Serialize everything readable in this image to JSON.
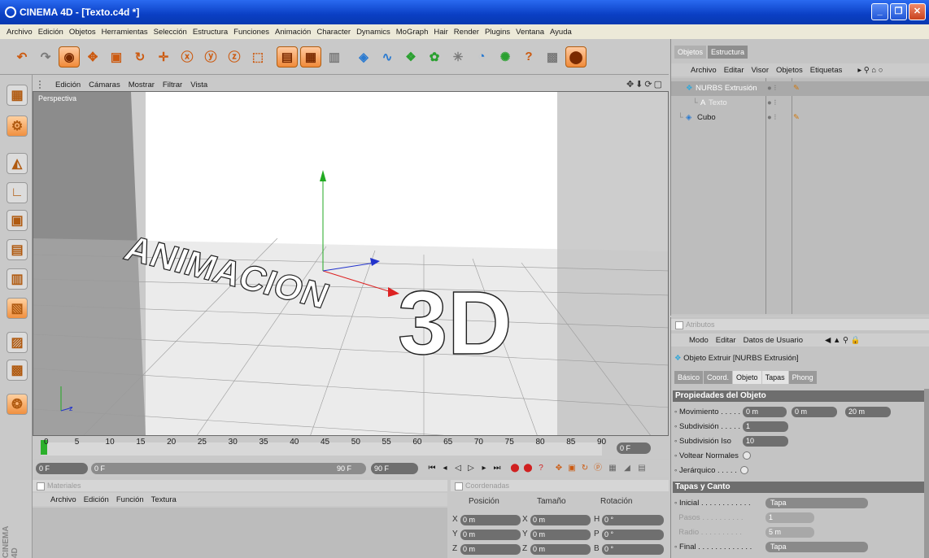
{
  "window": {
    "title": "CINEMA 4D - [Texto.c4d *]"
  },
  "menu": [
    "Archivo",
    "Edición",
    "Objetos",
    "Herramientas",
    "Selección",
    "Estructura",
    "Funciones",
    "Animación",
    "Character",
    "Dynamics",
    "MoGraph",
    "Hair",
    "Render",
    "Plugins",
    "Ventana",
    "Ayuda"
  ],
  "viewport": {
    "menu": [
      "Edición",
      "Cámaras",
      "Mostrar",
      "Filtrar",
      "Vista"
    ],
    "label": "Perspectiva",
    "text_left": "ANIMACION",
    "text_right": "3D"
  },
  "timeline": {
    "ticks": [
      "0",
      "5",
      "10",
      "15",
      "20",
      "25",
      "30",
      "35",
      "40",
      "45",
      "50",
      "55",
      "60",
      "65",
      "70",
      "75",
      "80",
      "85",
      "90"
    ],
    "current_frame": "0 F",
    "start": "0 F",
    "range_left": "0 F",
    "range_right": "90 F",
    "end": "90 F"
  },
  "materials": {
    "title": "Materiales",
    "menu": [
      "Archivo",
      "Edición",
      "Función",
      "Textura"
    ]
  },
  "coords": {
    "title": "Coordenadas",
    "headers": [
      "Posición",
      "Tamaño",
      "Rotación"
    ],
    "rows": [
      {
        "a": "X",
        "av": "0 m",
        "b": "X",
        "bv": "0 m",
        "c": "H",
        "cv": "0 °"
      },
      {
        "a": "Y",
        "av": "0 m",
        "b": "Y",
        "bv": "0 m",
        "c": "P",
        "cv": "0 °"
      },
      {
        "a": "Z",
        "av": "0 m",
        "b": "Z",
        "bv": "0 m",
        "c": "B",
        "cv": "0 °"
      }
    ]
  },
  "objects": {
    "tabs": [
      "Objetos",
      "Estructura"
    ],
    "menu": [
      "Archivo",
      "Editar",
      "Visor",
      "Objetos",
      "Etiquetas"
    ],
    "items": [
      {
        "name": "NURBS Extrusión"
      },
      {
        "name": "Texto"
      },
      {
        "name": "Cubo"
      }
    ]
  },
  "attributes": {
    "title": "Atributos",
    "menu": [
      "Modo",
      "Editar",
      "Datos de Usuario"
    ],
    "object_title": "Objeto Extruir [NURBS Extrusión]",
    "tabs": [
      "Básico",
      "Coord.",
      "Objeto",
      "Tapas",
      "Phong"
    ],
    "section1": "Propiedades del Objeto",
    "movimiento_label": "Movimiento",
    "movimiento": [
      "0 m",
      "0 m",
      "20 m"
    ],
    "subdivision_label": "Subdivisión",
    "subdivision": "1",
    "subdivision_iso_label": "Subdivisión Iso",
    "subdivision_iso": "10",
    "voltear_label": "Voltear Normales",
    "jerarquico_label": "Jerárquico",
    "section2": "Tapas y Canto",
    "inicial_label": "Inicial",
    "inicial": "Tapa",
    "pasos_label": "Pasos",
    "pasos": "1",
    "radio_label": "Radio",
    "radio": "5 m",
    "final_label": "Final",
    "final": "Tapa"
  },
  "branding": "CINEMA 4D"
}
